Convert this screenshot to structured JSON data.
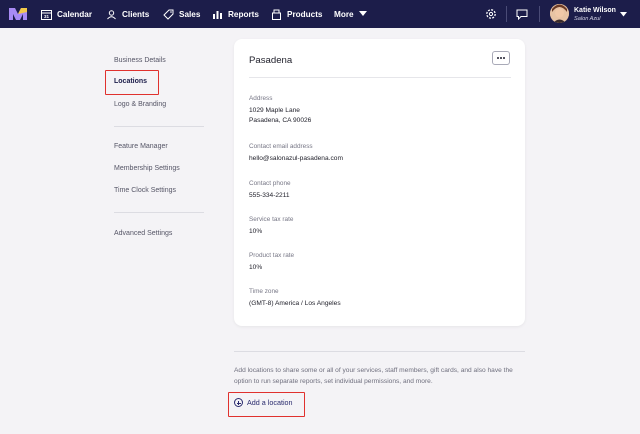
{
  "topnav": {
    "items": [
      {
        "label": "Calendar",
        "icon": "calendar-icon"
      },
      {
        "label": "Clients",
        "icon": "clients-icon"
      },
      {
        "label": "Sales",
        "icon": "tag-icon"
      },
      {
        "label": "Reports",
        "icon": "bar-chart-icon"
      },
      {
        "label": "Products",
        "icon": "products-icon"
      },
      {
        "label": "More",
        "icon": "caret-down-icon"
      }
    ],
    "user": {
      "name": "Katie Wilson",
      "business": "Salon Azul"
    },
    "colors": {
      "nav_bg": "#1c1d4a",
      "accent": "#2a2b6e",
      "highlight": "#e0312e"
    }
  },
  "sidebar": {
    "items": [
      {
        "label": "Business Details"
      },
      {
        "label": "Locations"
      },
      {
        "label": "Logo & Branding"
      },
      {
        "label": "Feature Manager"
      },
      {
        "label": "Membership Settings"
      },
      {
        "label": "Time Clock Settings"
      },
      {
        "label": "Advanced Settings"
      }
    ]
  },
  "location": {
    "name": "Pasadena",
    "fields": [
      {
        "label": "Address",
        "value_line1": "1029 Maple Lane",
        "value_line2": "Pasadena, CA 90026"
      },
      {
        "label": "Contact email address",
        "value_line1": "hello@salonazul-pasadena.com"
      },
      {
        "label": "Contact phone",
        "value_line1": "555-334-2211"
      },
      {
        "label": "Service tax rate",
        "value_line1": "10%"
      },
      {
        "label": "Product tax rate",
        "value_line1": "10%"
      },
      {
        "label": "Time zone",
        "value_line1": "(GMT-8) America / Los Angeles"
      }
    ]
  },
  "footer": {
    "help_text": "Add locations to share some or all of your services, staff members, gift cards, and also have the option to run separate reports, set individual permissions, and more.",
    "add_location_label": "Add a location"
  }
}
